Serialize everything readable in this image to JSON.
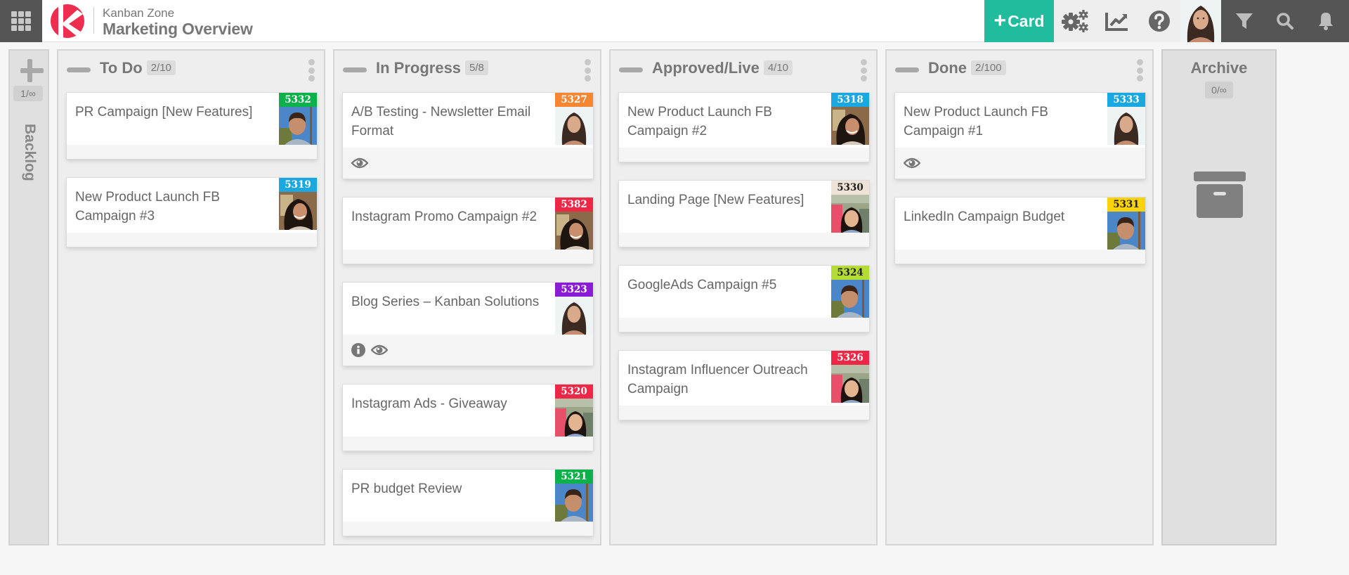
{
  "header": {
    "app_name": "Kanban Zone",
    "board_title": "Marketing Overview",
    "add_card_label": "Card",
    "brand_color": "#20bc9d",
    "logo_color": "#ee2e4f"
  },
  "backlog": {
    "label": "Backlog",
    "wip": "1/∞"
  },
  "columns": [
    {
      "title": "To Do",
      "wip": "2/10",
      "cards": [
        {
          "id": "5332",
          "title": "PR Campaign [New Features]",
          "id_color": "#0db14b",
          "id_text_color": "#ffffff",
          "avatar": "man",
          "icons": []
        },
        {
          "id": "5319",
          "title": "New Product Launch FB Campaign #3",
          "id_color": "#1ba8e0",
          "id_text_color": "#ffffff",
          "avatar": "woman-curly",
          "icons": []
        }
      ]
    },
    {
      "title": "In Progress",
      "wip": "5/8",
      "cards": [
        {
          "id": "5327",
          "title": "A/B Testing - Newsletter Email Format",
          "id_color": "#f58733",
          "id_text_color": "#ffffff",
          "avatar": "woman-long",
          "icons": [
            "eye-icon"
          ]
        },
        {
          "id": "5382",
          "title": "Instagram Promo Campaign #2",
          "id_color": "#ee2747",
          "id_text_color": "#ffffff",
          "avatar": "woman-curly",
          "icons": []
        },
        {
          "id": "5323",
          "title": "Blog Series – Kanban Solutions",
          "id_color": "#8a1cd6",
          "id_text_color": "#ffffff",
          "avatar": "woman-long",
          "icons": [
            "info-icon",
            "eye-icon"
          ]
        },
        {
          "id": "5320",
          "title": "Instagram Ads - Giveaway",
          "id_color": "#ee2747",
          "id_text_color": "#ffffff",
          "avatar": "woman-flowers",
          "icons": []
        },
        {
          "id": "5321",
          "title": "PR budget Review",
          "id_color": "#0db14b",
          "id_text_color": "#ffffff",
          "avatar": "man",
          "icons": []
        }
      ]
    },
    {
      "title": "Approved/Live",
      "wip": "4/10",
      "cards": [
        {
          "id": "5318",
          "title": "New Product Launch FB Campaign #2",
          "id_color": "#1ba8e0",
          "id_text_color": "#ffffff",
          "avatar": "woman-curly",
          "icons": []
        },
        {
          "id": "5330",
          "title": "Landing Page [New Features]",
          "id_color": "#efe2d6",
          "id_text_color": "#222222",
          "avatar": "woman-flowers",
          "icons": []
        },
        {
          "id": "5324",
          "title": "GoogleAds Campaign #5",
          "id_color": "#b5dc34",
          "id_text_color": "#222222",
          "avatar": "man",
          "icons": []
        },
        {
          "id": "5326",
          "title": "Instagram Influencer Outreach Campaign",
          "id_color": "#ee2747",
          "id_text_color": "#ffffff",
          "avatar": "woman-flowers",
          "icons": []
        }
      ]
    },
    {
      "title": "Done",
      "wip": "2/100",
      "cards": [
        {
          "id": "5333",
          "title": "New Product Launch FB Campaign #1",
          "id_color": "#1ba8e0",
          "id_text_color": "#ffffff",
          "avatar": "woman-long",
          "icons": [
            "eye-icon"
          ]
        },
        {
          "id": "5331",
          "title": "LinkedIn Campaign Budget",
          "id_color": "#fcd20b",
          "id_text_color": "#222222",
          "avatar": "man",
          "icons": []
        }
      ]
    }
  ],
  "archive": {
    "title": "Archive",
    "wip": "0/∞"
  }
}
